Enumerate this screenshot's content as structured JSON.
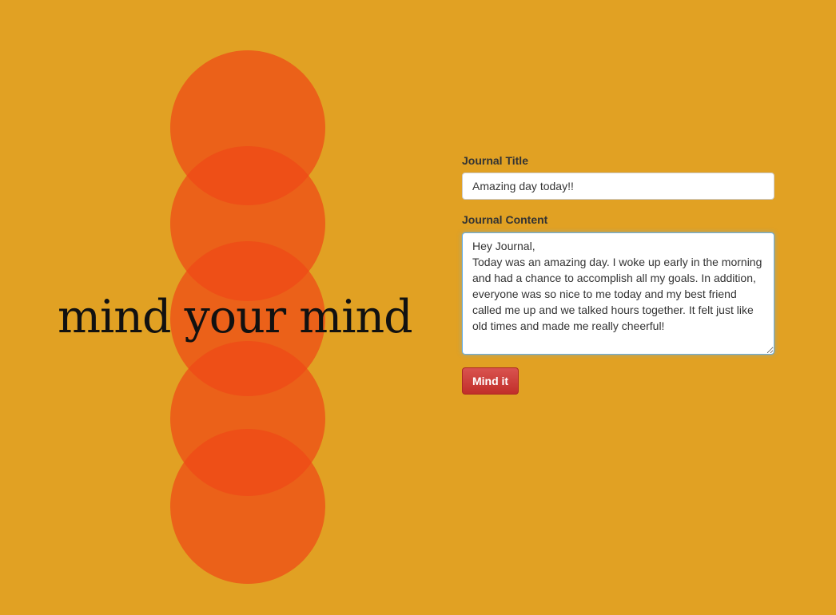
{
  "theme": {
    "background": "#E1A123",
    "circle_color": "#EF4816",
    "button_color": "#D9534F"
  },
  "hero": {
    "tagline": "mind your mind"
  },
  "form": {
    "title_label": "Journal Title",
    "title_value": "Amazing day today!!",
    "content_label": "Journal Content",
    "content_value": "Hey Journal,\nToday was an amazing day. I woke up early in the morning and had a chance to accomplish all my goals. In addition, everyone was so nice to me today and my best friend called me up and we talked hours together. It felt just like old times and made me really cheerful! ",
    "submit_label": "Mind it"
  }
}
